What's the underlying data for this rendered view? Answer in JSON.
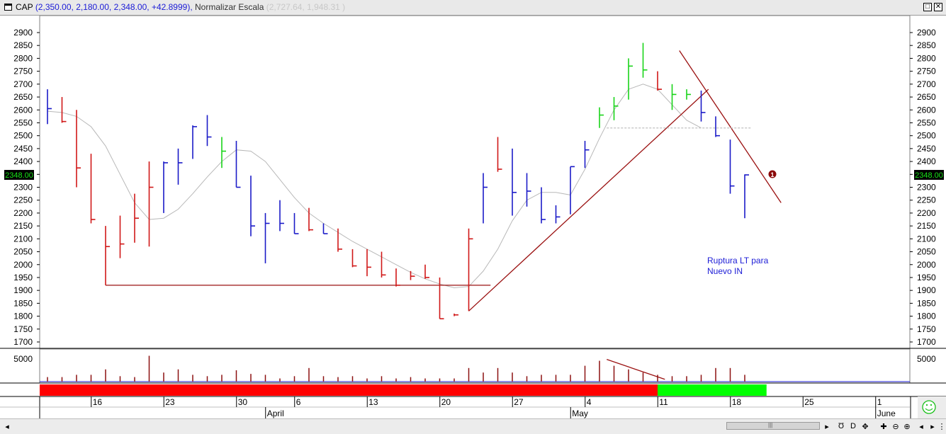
{
  "window": {
    "symbol": "CAP",
    "ohlc_text": "(2,350.00, 2,180.00, 2,348.00, +42.8999),",
    "normalize_text": "Normalizar Escala",
    "range_text": "(2,727.64, 1,948.31 )",
    "minimize_label": "□",
    "close_label": "✕"
  },
  "price_tag": "2348.00",
  "annotation": {
    "line1": "Ruptura LT para",
    "line2": "Nuevo IN"
  },
  "marker": "1",
  "volume_tick": "5000",
  "status": {
    "nav_icons": [
      "◂",
      "▸",
      "Ʊ",
      "D",
      "✥",
      "✚",
      "⊖",
      "⊕",
      "◂",
      "▸",
      "⋮"
    ]
  },
  "chart_data": {
    "type": "ohlc",
    "title": "CAP",
    "ylim": [
      1680,
      2950
    ],
    "yticks": [
      1700,
      1750,
      1800,
      1850,
      1900,
      1950,
      2000,
      2050,
      2100,
      2150,
      2200,
      2250,
      2300,
      2350,
      2400,
      2450,
      2500,
      2550,
      2600,
      2650,
      2700,
      2750,
      2800,
      2850,
      2900
    ],
    "x_day_labels": [
      {
        "label": "16",
        "bar": 3.5
      },
      {
        "label": "23",
        "bar": 8.5
      },
      {
        "label": "30",
        "bar": 13.5
      },
      {
        "label": "6",
        "bar": 17.5
      },
      {
        "label": "13",
        "bar": 22.5
      },
      {
        "label": "20",
        "bar": 27.5
      },
      {
        "label": "27",
        "bar": 32.5
      },
      {
        "label": "4",
        "bar": 37.5
      },
      {
        "label": "11",
        "bar": 42.5
      },
      {
        "label": "18",
        "bar": 47.5
      },
      {
        "label": "25",
        "bar": 52.5
      },
      {
        "label": "1",
        "bar": 57.5
      }
    ],
    "x_month_labels": [
      {
        "label": "April",
        "bar": 15.5
      },
      {
        "label": "May",
        "bar": 36.5
      },
      {
        "label": "June",
        "bar": 57.5
      }
    ],
    "bars": [
      {
        "h": 2680,
        "l": 2545,
        "c": 2605,
        "color": "blue"
      },
      {
        "h": 2650,
        "l": 2550,
        "c": 2555,
        "color": "red"
      },
      {
        "h": 2600,
        "l": 2300,
        "c": 2375,
        "color": "red"
      },
      {
        "h": 2430,
        "l": 2160,
        "c": 2175,
        "color": "red"
      },
      {
        "h": 2150,
        "l": 1920,
        "c": 2070,
        "color": "red"
      },
      {
        "h": 2190,
        "l": 2025,
        "c": 2080,
        "color": "red"
      },
      {
        "h": 2275,
        "l": 2085,
        "c": 2180,
        "color": "red"
      },
      {
        "h": 2400,
        "l": 2070,
        "c": 2300,
        "color": "red"
      },
      {
        "h": 2400,
        "l": 2200,
        "c": 2395,
        "color": "blue"
      },
      {
        "h": 2450,
        "l": 2310,
        "c": 2395,
        "color": "blue"
      },
      {
        "h": 2540,
        "l": 2410,
        "c": 2535,
        "color": "blue"
      },
      {
        "h": 2580,
        "l": 2460,
        "c": 2495,
        "color": "blue"
      },
      {
        "h": 2495,
        "l": 2375,
        "c": 2440,
        "color": "green"
      },
      {
        "h": 2480,
        "l": 2300,
        "c": 2300,
        "color": "blue"
      },
      {
        "h": 2345,
        "l": 2110,
        "c": 2150,
        "color": "blue"
      },
      {
        "h": 2200,
        "l": 2005,
        "c": 2160,
        "color": "blue"
      },
      {
        "h": 2250,
        "l": 2130,
        "c": 2160,
        "color": "blue"
      },
      {
        "h": 2200,
        "l": 2120,
        "c": 2120,
        "color": "blue"
      },
      {
        "h": 2220,
        "l": 2130,
        "c": 2135,
        "color": "red"
      },
      {
        "h": 2160,
        "l": 2120,
        "c": 2120,
        "color": "blue"
      },
      {
        "h": 2140,
        "l": 2050,
        "c": 2060,
        "color": "red"
      },
      {
        "h": 2060,
        "l": 1990,
        "c": 1995,
        "color": "red"
      },
      {
        "h": 2060,
        "l": 1955,
        "c": 1990,
        "color": "red"
      },
      {
        "h": 2050,
        "l": 1950,
        "c": 1960,
        "color": "red"
      },
      {
        "h": 1985,
        "l": 1915,
        "c": 1920,
        "color": "red"
      },
      {
        "h": 1975,
        "l": 1940,
        "c": 1955,
        "color": "red"
      },
      {
        "h": 2000,
        "l": 1945,
        "c": 1950,
        "color": "red"
      },
      {
        "h": 1950,
        "l": 1790,
        "c": 1790,
        "color": "red"
      },
      {
        "h": 1810,
        "l": 1800,
        "c": 1805,
        "color": "red"
      },
      {
        "h": 2140,
        "l": 1820,
        "c": 2100,
        "color": "red"
      },
      {
        "h": 2355,
        "l": 2160,
        "c": 2300,
        "color": "blue"
      },
      {
        "h": 2495,
        "l": 2360,
        "c": 2370,
        "color": "red"
      },
      {
        "h": 2450,
        "l": 2190,
        "c": 2280,
        "color": "blue"
      },
      {
        "h": 2355,
        "l": 2225,
        "c": 2285,
        "color": "blue"
      },
      {
        "h": 2300,
        "l": 2160,
        "c": 2175,
        "color": "blue"
      },
      {
        "h": 2230,
        "l": 2160,
        "c": 2185,
        "color": "blue"
      },
      {
        "h": 2380,
        "l": 2195,
        "c": 2380,
        "color": "blue"
      },
      {
        "h": 2480,
        "l": 2375,
        "c": 2445,
        "color": "blue"
      },
      {
        "h": 2610,
        "l": 2530,
        "c": 2580,
        "color": "green"
      },
      {
        "h": 2650,
        "l": 2560,
        "c": 2615,
        "color": "green"
      },
      {
        "h": 2800,
        "l": 2640,
        "c": 2770,
        "color": "green"
      },
      {
        "h": 2860,
        "l": 2725,
        "c": 2755,
        "color": "green"
      },
      {
        "h": 2750,
        "l": 2675,
        "c": 2680,
        "color": "red"
      },
      {
        "h": 2700,
        "l": 2600,
        "c": 2660,
        "color": "green"
      },
      {
        "h": 2680,
        "l": 2640,
        "c": 2660,
        "color": "green"
      },
      {
        "h": 2675,
        "l": 2555,
        "c": 2590,
        "color": "blue"
      },
      {
        "h": 2575,
        "l": 2495,
        "c": 2500,
        "color": "blue"
      },
      {
        "h": 2485,
        "l": 2275,
        "c": 2305,
        "color": "blue"
      },
      {
        "h": 2350,
        "l": 2180,
        "c": 2348,
        "color": "blue"
      }
    ],
    "moving_average": [
      2595,
      2590,
      2575,
      2535,
      2460,
      2350,
      2240,
      2175,
      2180,
      2215,
      2275,
      2340,
      2400,
      2445,
      2440,
      2400,
      2330,
      2260,
      2200,
      2160,
      2125,
      2090,
      2060,
      2030,
      2000,
      1970,
      1945,
      1925,
      1910,
      1915,
      1975,
      2060,
      2170,
      2250,
      2280,
      2280,
      2270,
      2370,
      2490,
      2600,
      2680,
      2700,
      2680,
      2620,
      2560,
      2530
    ],
    "volume": [
      1000,
      1000,
      1500,
      1500,
      2700,
      1200,
      1000,
      5700,
      2000,
      2700,
      1500,
      1200,
      1500,
      2500,
      1700,
      1500,
      700,
      1200,
      3000,
      1200,
      1000,
      1200,
      700,
      1200,
      700,
      1000,
      700,
      700,
      700,
      3000,
      2000,
      3000,
      2000,
      1200,
      1500,
      1500,
      1500,
      3500,
      4600,
      3500,
      2700,
      2000,
      1500,
      1200,
      1200,
      1500,
      3000,
      3000,
      1500
    ],
    "trendlines": [
      {
        "from": {
          "bar": 4.0,
          "y": 1920
        },
        "to": {
          "bar": 30.5,
          "y": 1920
        },
        "color": "#9a1010",
        "label": "support"
      },
      {
        "from": {
          "bar": 29.0,
          "y": 1820
        },
        "to": {
          "bar": 45.5,
          "y": 2680
        },
        "color": "#9a1010",
        "label": "uptrend"
      },
      {
        "from": {
          "bar": 43.5,
          "y": 2830
        },
        "to": {
          "bar": 50.5,
          "y": 2240
        },
        "color": "#9a1010",
        "label": "downtrend"
      },
      {
        "from": {
          "bar": 38.5,
          "y": 2530
        },
        "to": {
          "bar": 48.5,
          "y": 2530
        },
        "color": "#c0c0c0",
        "label": "dashed",
        "dashed": true
      },
      {
        "from": {
          "bar": 38.5,
          "y": 4900
        },
        "to": {
          "bar": 42.5,
          "y": 500
        },
        "color": "#9a1010",
        "label": "volume-trend",
        "pane": "volume"
      }
    ],
    "sentiment_bar": {
      "red_until_bar": 42.0,
      "green_until_bar": 49.5
    }
  }
}
